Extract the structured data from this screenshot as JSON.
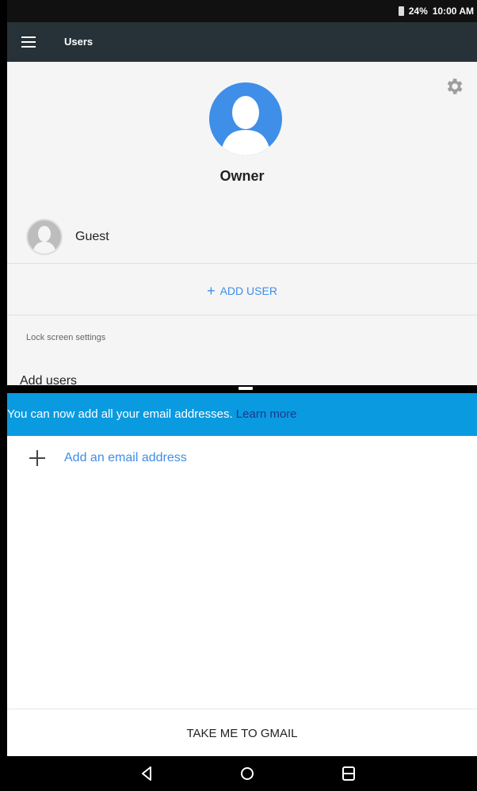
{
  "status_bar": {
    "battery": "24%",
    "time": "10:00 AM"
  },
  "app_bar": {
    "title": "Users"
  },
  "users_screen": {
    "owner_label": "Owner",
    "guest_label": "Guest",
    "add_user_label": "ADD USER",
    "lock_screen_settings": "Lock screen settings",
    "add_users_label": "Add users"
  },
  "email_panel": {
    "banner_text": "You can now add all your email addresses.",
    "banner_link": "Learn more",
    "add_email_label": "Add an email address",
    "gmail_button": "TAKE ME TO GMAIL"
  },
  "colors": {
    "accent": "#3f8ee8",
    "banner": "#0a9ae0",
    "app_bar": "#263238",
    "link": "#1a3a8c"
  },
  "icons": [
    "battery-icon",
    "menu-icon",
    "settings-gear-icon",
    "owner-avatar-icon",
    "guest-avatar-icon",
    "plus-icon",
    "back-icon",
    "home-icon",
    "recents-icon"
  ]
}
